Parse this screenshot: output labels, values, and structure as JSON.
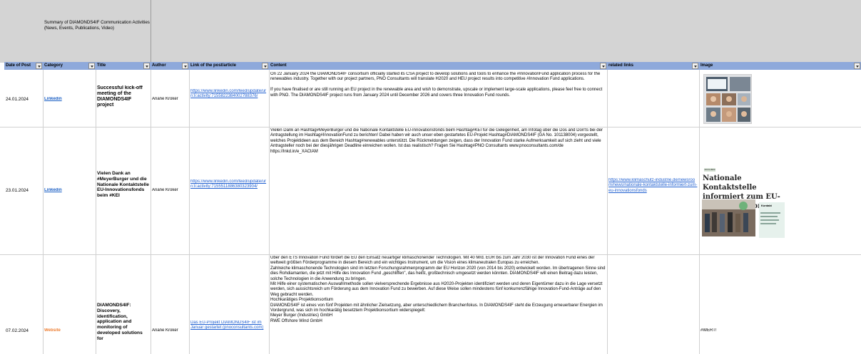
{
  "banner": {
    "line1": "Summary of DIAMONDS4IF Communication Activities",
    "line2": "(News, Events, Publications, Video)"
  },
  "headers": {
    "date": "Date of Post",
    "category": "Category",
    "title": "Title",
    "author": "Author",
    "link": "Link of the post/article",
    "content": "Content",
    "related": "related links",
    "image": "Image"
  },
  "rows": [
    {
      "date": "24.01.2024",
      "category": "Linkedin",
      "title": "Successful kick-off meeting of the DIAMONDS4IF project",
      "author": "Ariane Kroker",
      "link": "https://www.linkedin.com/feed/update/urn:li:activity:7155822384002788376/",
      "content": "On 22 January 2024 the DIAMONDS4IF consortium officially started its CSA project to develop solutions and tools to enhance the #InnovationFund application process for the renewables industry. Together with our project partners, PNO Consultants will translate H2020 and HEU project results into competitive #Innovation Fund applications.\n\nIf you have finalised or are still running an EU project in the renewable area and wish to demonstrate, upscale or implement large-scale applications, please feel free to connect with PNO. The DIAMONDS4IF project runs from January 2024 until December 2026 and covers three Innovation Fund rounds.",
      "related": "",
      "image": ""
    },
    {
      "date": "23.01.2024",
      "category": "Linkedin",
      "title": "Vielen Dank an #MeyerBurger und die Nationale Kontaktstelle EU-Innovationsfonds beim #KEI",
      "author": "Ariane Kroker",
      "link": "https://www.linkedin.com/feed/update/urn:li:activity:7155511886380323904/",
      "content": "Vielen Dank an Hashtag#MeyerBurger und die Nationale Kontaktstelle EU-Innovationsfonds beim Hashtag#KEI für die Gelegenheit, am Infotag über die Dos and Don'ts bei der Antragstellung im Hashtag#InnovationFund zu berichten! Dabei haben wir auch unser eben gestartetes EU-Projekt Hashtag#DIAMONDS4IF (GA No. 101138004) vorgestellt, welches Projektideen aus dem Bereich Hashtag#renewables unterstützt. Die Rückmeldungen zeigen, dass der Innovation Fund starke Aufmerksamkeit auf sich zieht und viele Antragsteller noch bei der diesjährigen Deadline einreichen wollen. Ist das realistisch? Fragen Sie Hashtag#PNO Consultants www.pnoconsultants.com/de\nhttps://lnkd.in/e_XACtAM",
      "related": "https://www.klimaschutz-industrie.de/newsroom/news/nationale-kontaktstelle-informiert-zum-eu-innovationsfonds",
      "image_tag": "23.01.2024",
      "image_headline": "Nationale Kontaktstelle informiert zum EU-Innovationsfonds",
      "image_kontakt": "Kontakt"
    },
    {
      "date": "07.02.2024",
      "category": "Website",
      "title": "DIAMONDS4IF: Discovery, identification, application and monitoring of developed solutions for",
      "author": "Ariane Kroker",
      "link": "Das EU-Projekt DIAMONDS4IF ist im Januar gestartet (pnoconsultants.com)",
      "content": "Über den ETS Innovation Fund fördert die EU den Einsatz neuartiger klimaschonender Technologien. Mit 40 Mrd. EUR bis zum Jahr 2030 ist der Innovation Fund eines der weltweit größten Förderprogramme in diesem Bereich und ein wichtiges Instrument, um die Vision eines klimaneutralen Europas zu erreichen.\nZahlreiche klimaschonende Technologien sind im letzten Forschungsrahmenprogramm der EU Horizon 2020 (von 2014 bis 2020) entwickelt worden. Im übertragenen Sinne sind dies Rohdiamanten, die jetzt mit Hilfe des Innovation Fund „geschliffen\", das heißt, großtechnisch umgesetzt werden könnten. DIAMONDS4IF will einen Beitrag dazu leisten, solche Technologien in die Anwendung zu bringen.\nMit Hilfe einer systematischen Auswahlmethode sollen vielversprechende Ergebnisse aus H2020-Projekten identifiziert werden und deren Eigentümer dazu in die Lage versetzt werden, sich aussichtsreich um Förderung aus dem Innovation Fund zu bewerben. Auf diese Weise sollen mindestens fünf konkurrenzfähige Innovation-Fund-Anträge auf den Weg gebracht werden.\nHochkarätiges Projektkonsortium\nDIAMONDS4IF ist eines von fünf Projekten mit ähnlicher Zielsetzung, aber unterschiedlichem Branchenfokus. In DIAMONDS4IF steht die Erzeugung erneuerbarer Energien im Vordergrund, was sich im hochkarätig besetztem Projektkonsortium widerspiegelt:\nMeyer Burger (Industries) GmbH\nRWE Offshore Wind GmbH",
      "related": "",
      "image": "#WERT!"
    }
  ],
  "colors": {
    "banner_bg": "#d4d4d4",
    "header_bg": "#8ea9db",
    "link_blue": "#1a5ec4",
    "website_orange": "#ed7d31"
  }
}
